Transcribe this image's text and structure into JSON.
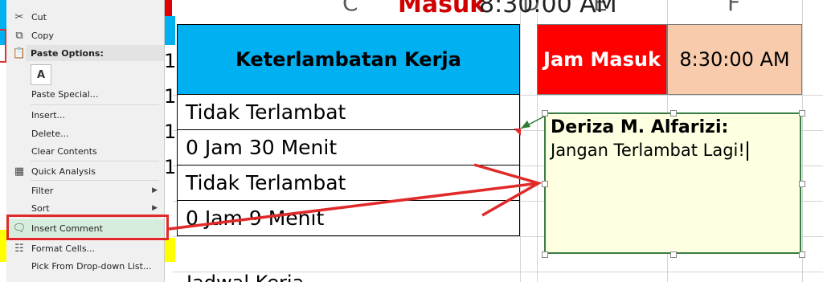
{
  "sheet": {
    "top_partial_red": "Masuk",
    "top_partial_value": "8:30:00 AM",
    "col_headers": [
      "C",
      "D",
      "E",
      "F"
    ],
    "left_row_fragments": [
      "1",
      "1",
      "1",
      "1"
    ],
    "bottom_partial_text": "Jadwal Kerja"
  },
  "table": {
    "header": "Keterlambatan Kerja",
    "rows": [
      "Tidak Terlambat",
      "0 Jam 30 Menit",
      "Tidak Terlambat",
      "0 Jam 9 Menit"
    ]
  },
  "jam": {
    "label": "Jam Masuk",
    "value": "8:30:00 AM"
  },
  "comment": {
    "author": "Deriza M. Alfarizi:",
    "text": "Jangan Terlambat Lagi!"
  },
  "menu": {
    "cut": "Cut",
    "copy": "Copy",
    "paste_options": "Paste Options:",
    "paste_special": "Paste Special...",
    "insert": "Insert...",
    "delete": "Delete...",
    "clear_contents": "Clear Contents",
    "quick_analysis": "Quick Analysis",
    "filter": "Filter",
    "sort": "Sort",
    "insert_comment": "Insert Comment",
    "format_cells": "Format Cells...",
    "pick_from_list": "Pick From Drop-down List..."
  },
  "colors": {
    "header_blue": "#00b0f0",
    "label_red": "#ff0000",
    "value_peach": "#f8cbad",
    "annotation_red": "#e02a2a",
    "comment_bg": "#ffffe1"
  }
}
